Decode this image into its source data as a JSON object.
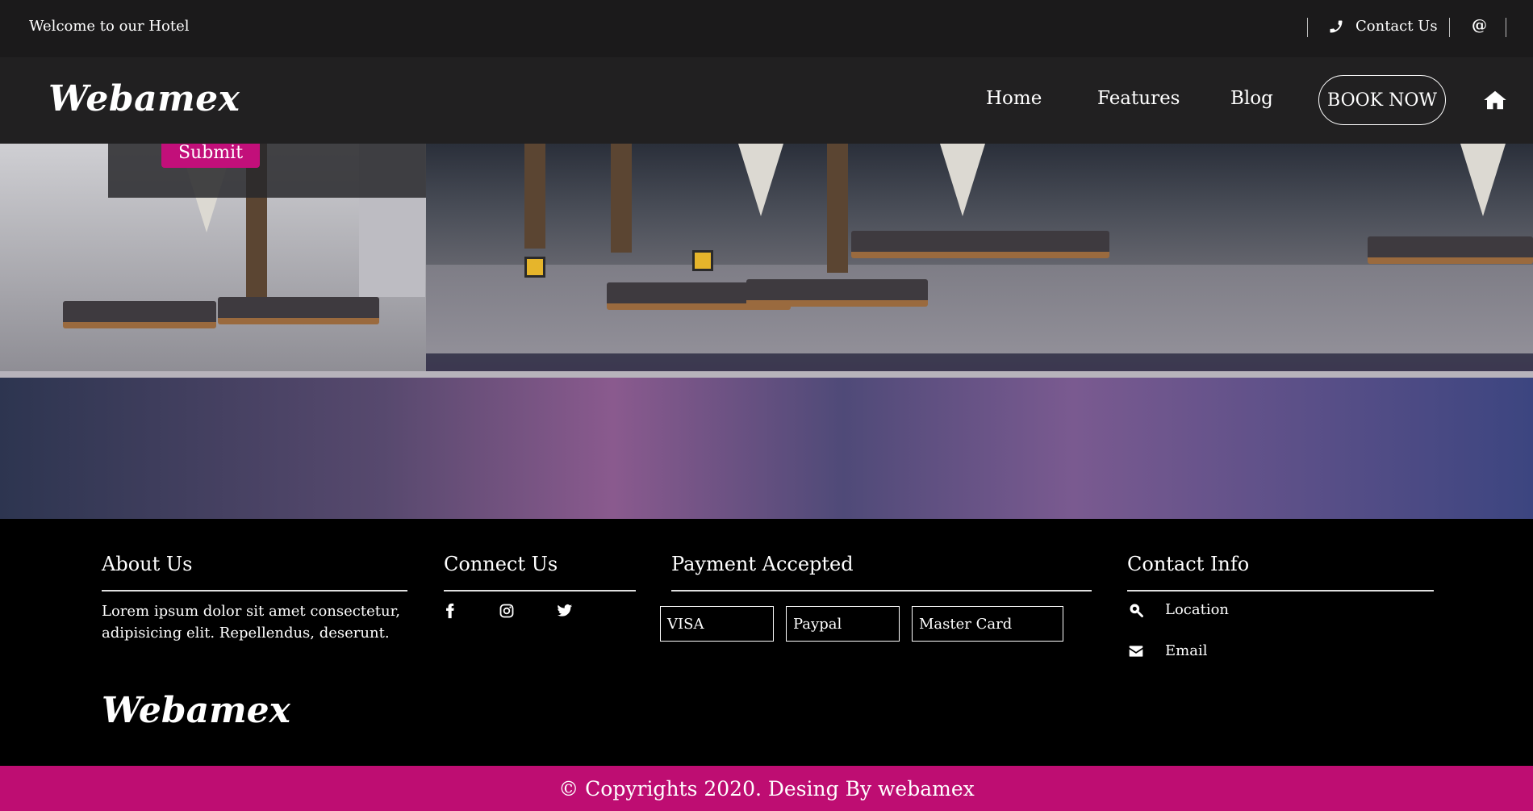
{
  "topbar": {
    "welcome": "Welcome to our Hotel",
    "contact_label": "Contact Us",
    "email_symbol": "@"
  },
  "nav": {
    "brand": "Webamex",
    "links": [
      "Home",
      "Features",
      "Blog"
    ],
    "cta": "BOOK NOW"
  },
  "hero": {
    "submit_label": "Submit"
  },
  "footer": {
    "about": {
      "title": "About Us",
      "text": "Lorem ipsum dolor sit amet consectetur, adipisicing elit. Repellendus, deserunt."
    },
    "connect": {
      "title": "Connect Us",
      "icons": [
        "facebook-icon",
        "instagram-icon",
        "twitter-icon"
      ]
    },
    "payment": {
      "title": "Payment Accepted",
      "methods": [
        "VISA",
        "Paypal",
        "Master Card"
      ]
    },
    "contact": {
      "title": "Contact Info",
      "location": "Location",
      "email": "Email"
    },
    "brand": "Webamex"
  },
  "copyright": "© Copyrights 2020. Desing By webamex",
  "colors": {
    "accent": "#be0d72",
    "topbar_bg": "#1b1a1b",
    "nav_bg": "#212021",
    "footer_bg": "#000000"
  }
}
